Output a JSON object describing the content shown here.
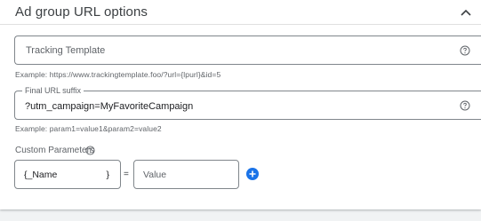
{
  "header": {
    "title": "Ad group URL options",
    "collapse_icon": "chevron-up-icon"
  },
  "tracking_template": {
    "placeholder": "Tracking Template",
    "help_icon": "help-circle-icon",
    "hint": "Example: https://www.trackingtemplate.foo/?url={lpurl}&id=5"
  },
  "final_url_suffix": {
    "label": "Final URL suffix",
    "value": "?utm_campaign=MyFavoriteCampaign",
    "help_icon": "help-circle-icon",
    "hint": "Example: param1=value1&param2=value2"
  },
  "custom_parameters": {
    "label": "Custom Parameters",
    "help_icon": "help-circle-icon",
    "name_prefix": "{_Name",
    "name_suffix": "}",
    "equals": "=",
    "value_placeholder": "Value",
    "add_icon": "add-circle-icon"
  },
  "colors": {
    "accent": "#1a73e8",
    "border": "#80868b",
    "muted_text": "#5f6368",
    "background": "#f1f3f4"
  }
}
